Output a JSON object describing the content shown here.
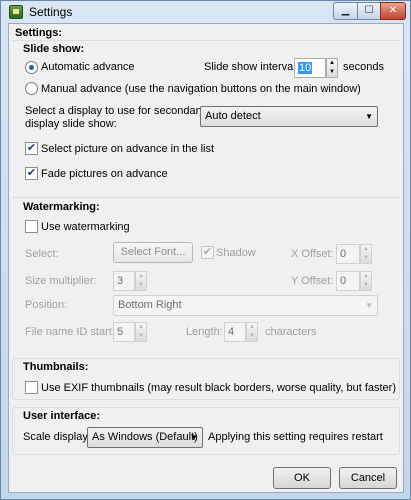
{
  "window": {
    "title": "Settings",
    "minimize_glyph": "▁",
    "maximize_glyph": "☐",
    "close_glyph": "✕"
  },
  "header": "Settings:",
  "slideshow": {
    "title": "Slide show:",
    "auto_label": "Automatic advance",
    "manual_label": "Manual advance (use the navigation buttons on the main window)",
    "interval_label": "Slide show interval:",
    "interval_value": "10",
    "interval_unit": "seconds",
    "display_label_line1": "Select a display to use for secondary",
    "display_label_line2": "display slide show:",
    "display_value": "Auto detect",
    "select_picture_label": "Select picture on advance in the list",
    "fade_label": "Fade pictures on advance",
    "auto_selected": true,
    "select_picture_checked": true,
    "fade_checked": true
  },
  "watermarking": {
    "title": "Watermarking:",
    "use_label": "Use watermarking",
    "use_checked": false,
    "select_label": "Select:",
    "select_font_button": "Select Font...",
    "shadow_label": "Shadow",
    "shadow_checked": true,
    "x_offset_label": "X Offset:",
    "x_offset_value": "0",
    "y_offset_label": "Y Offset:",
    "y_offset_value": "0",
    "size_label": "Size multiplier:",
    "size_value": "3",
    "position_label": "Position:",
    "position_value": "Bottom Right",
    "file_id_label": "File name ID start:",
    "file_id_value": "5",
    "length_label": "Length:",
    "length_value": "4",
    "characters_label": "characters"
  },
  "thumbnails": {
    "title": "Thumbnails:",
    "exif_label": "Use EXIF thumbnails (may result black borders, worse quality, but faster)",
    "exif_checked": false
  },
  "ui": {
    "title": "User interface:",
    "scale_label": "Scale display:",
    "scale_value": "As Windows (Default)",
    "applying_text": "Applying this setting requires restart"
  },
  "buttons": {
    "ok": "OK",
    "cancel": "Cancel"
  },
  "colors": {
    "selection": "#3399ff",
    "close_button": "#c2452d",
    "window_frame": "#c2d6ec"
  }
}
